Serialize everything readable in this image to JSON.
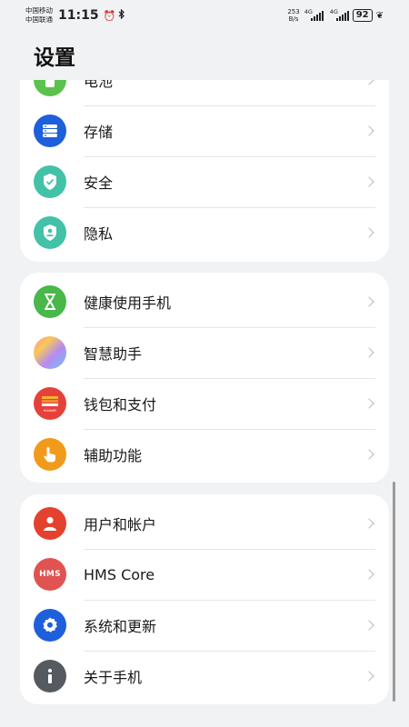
{
  "status_bar": {
    "carrier1": "中国移动",
    "carrier2": "中国联通",
    "time": "11:15",
    "netspeed_value": "253",
    "netspeed_unit": "B/s",
    "sim1_tag": "4G",
    "sim2_tag": "4G",
    "battery": "92"
  },
  "page": {
    "title": "设置"
  },
  "group1": [
    {
      "label": "电池",
      "icon": "battery-icon",
      "color": "#5ac24d"
    },
    {
      "label": "存储",
      "icon": "storage-icon",
      "color": "#1e5fdb"
    },
    {
      "label": "安全",
      "icon": "shield-icon",
      "color": "#43c2a8"
    },
    {
      "label": "隐私",
      "icon": "privacy-icon",
      "color": "#43c2a8"
    }
  ],
  "group2": [
    {
      "label": "健康使用手机",
      "icon": "hourglass-icon",
      "color": "#47b849"
    },
    {
      "label": "智慧助手",
      "icon": "assistant-icon",
      "color": "#c58cf0"
    },
    {
      "label": "钱包和支付",
      "icon": "wallet-icon",
      "color": "#e5413a",
      "badge": "HUAWEI"
    },
    {
      "label": "辅助功能",
      "icon": "hand-icon",
      "color": "#f29a1b"
    }
  ],
  "group3": [
    {
      "label": "用户和帐户",
      "icon": "user-icon",
      "color": "#e5412f"
    },
    {
      "label": "HMS Core",
      "icon": "hms-icon",
      "color": "#e15351",
      "badge": "HMS"
    },
    {
      "label": "系统和更新",
      "icon": "gear-icon",
      "color": "#1e5fdb"
    },
    {
      "label": "关于手机",
      "icon": "info-icon",
      "color": "#555a60"
    }
  ]
}
